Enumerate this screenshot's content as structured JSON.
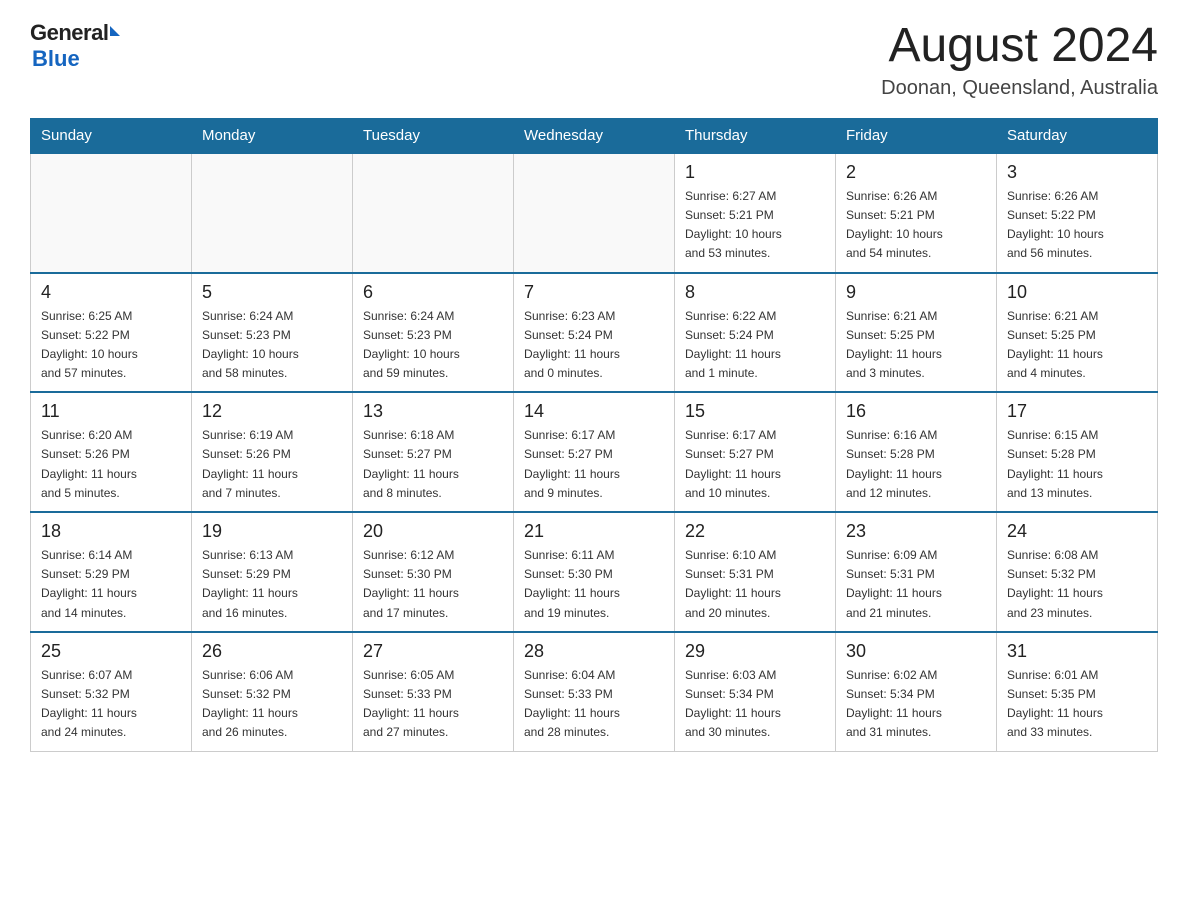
{
  "logo": {
    "general": "General",
    "blue": "Blue"
  },
  "header": {
    "title": "August 2024",
    "subtitle": "Doonan, Queensland, Australia"
  },
  "days_of_week": [
    "Sunday",
    "Monday",
    "Tuesday",
    "Wednesday",
    "Thursday",
    "Friday",
    "Saturday"
  ],
  "weeks": [
    [
      {
        "day": "",
        "info": ""
      },
      {
        "day": "",
        "info": ""
      },
      {
        "day": "",
        "info": ""
      },
      {
        "day": "",
        "info": ""
      },
      {
        "day": "1",
        "info": "Sunrise: 6:27 AM\nSunset: 5:21 PM\nDaylight: 10 hours\nand 53 minutes."
      },
      {
        "day": "2",
        "info": "Sunrise: 6:26 AM\nSunset: 5:21 PM\nDaylight: 10 hours\nand 54 minutes."
      },
      {
        "day": "3",
        "info": "Sunrise: 6:26 AM\nSunset: 5:22 PM\nDaylight: 10 hours\nand 56 minutes."
      }
    ],
    [
      {
        "day": "4",
        "info": "Sunrise: 6:25 AM\nSunset: 5:22 PM\nDaylight: 10 hours\nand 57 minutes."
      },
      {
        "day": "5",
        "info": "Sunrise: 6:24 AM\nSunset: 5:23 PM\nDaylight: 10 hours\nand 58 minutes."
      },
      {
        "day": "6",
        "info": "Sunrise: 6:24 AM\nSunset: 5:23 PM\nDaylight: 10 hours\nand 59 minutes."
      },
      {
        "day": "7",
        "info": "Sunrise: 6:23 AM\nSunset: 5:24 PM\nDaylight: 11 hours\nand 0 minutes."
      },
      {
        "day": "8",
        "info": "Sunrise: 6:22 AM\nSunset: 5:24 PM\nDaylight: 11 hours\nand 1 minute."
      },
      {
        "day": "9",
        "info": "Sunrise: 6:21 AM\nSunset: 5:25 PM\nDaylight: 11 hours\nand 3 minutes."
      },
      {
        "day": "10",
        "info": "Sunrise: 6:21 AM\nSunset: 5:25 PM\nDaylight: 11 hours\nand 4 minutes."
      }
    ],
    [
      {
        "day": "11",
        "info": "Sunrise: 6:20 AM\nSunset: 5:26 PM\nDaylight: 11 hours\nand 5 minutes."
      },
      {
        "day": "12",
        "info": "Sunrise: 6:19 AM\nSunset: 5:26 PM\nDaylight: 11 hours\nand 7 minutes."
      },
      {
        "day": "13",
        "info": "Sunrise: 6:18 AM\nSunset: 5:27 PM\nDaylight: 11 hours\nand 8 minutes."
      },
      {
        "day": "14",
        "info": "Sunrise: 6:17 AM\nSunset: 5:27 PM\nDaylight: 11 hours\nand 9 minutes."
      },
      {
        "day": "15",
        "info": "Sunrise: 6:17 AM\nSunset: 5:27 PM\nDaylight: 11 hours\nand 10 minutes."
      },
      {
        "day": "16",
        "info": "Sunrise: 6:16 AM\nSunset: 5:28 PM\nDaylight: 11 hours\nand 12 minutes."
      },
      {
        "day": "17",
        "info": "Sunrise: 6:15 AM\nSunset: 5:28 PM\nDaylight: 11 hours\nand 13 minutes."
      }
    ],
    [
      {
        "day": "18",
        "info": "Sunrise: 6:14 AM\nSunset: 5:29 PM\nDaylight: 11 hours\nand 14 minutes."
      },
      {
        "day": "19",
        "info": "Sunrise: 6:13 AM\nSunset: 5:29 PM\nDaylight: 11 hours\nand 16 minutes."
      },
      {
        "day": "20",
        "info": "Sunrise: 6:12 AM\nSunset: 5:30 PM\nDaylight: 11 hours\nand 17 minutes."
      },
      {
        "day": "21",
        "info": "Sunrise: 6:11 AM\nSunset: 5:30 PM\nDaylight: 11 hours\nand 19 minutes."
      },
      {
        "day": "22",
        "info": "Sunrise: 6:10 AM\nSunset: 5:31 PM\nDaylight: 11 hours\nand 20 minutes."
      },
      {
        "day": "23",
        "info": "Sunrise: 6:09 AM\nSunset: 5:31 PM\nDaylight: 11 hours\nand 21 minutes."
      },
      {
        "day": "24",
        "info": "Sunrise: 6:08 AM\nSunset: 5:32 PM\nDaylight: 11 hours\nand 23 minutes."
      }
    ],
    [
      {
        "day": "25",
        "info": "Sunrise: 6:07 AM\nSunset: 5:32 PM\nDaylight: 11 hours\nand 24 minutes."
      },
      {
        "day": "26",
        "info": "Sunrise: 6:06 AM\nSunset: 5:32 PM\nDaylight: 11 hours\nand 26 minutes."
      },
      {
        "day": "27",
        "info": "Sunrise: 6:05 AM\nSunset: 5:33 PM\nDaylight: 11 hours\nand 27 minutes."
      },
      {
        "day": "28",
        "info": "Sunrise: 6:04 AM\nSunset: 5:33 PM\nDaylight: 11 hours\nand 28 minutes."
      },
      {
        "day": "29",
        "info": "Sunrise: 6:03 AM\nSunset: 5:34 PM\nDaylight: 11 hours\nand 30 minutes."
      },
      {
        "day": "30",
        "info": "Sunrise: 6:02 AM\nSunset: 5:34 PM\nDaylight: 11 hours\nand 31 minutes."
      },
      {
        "day": "31",
        "info": "Sunrise: 6:01 AM\nSunset: 5:35 PM\nDaylight: 11 hours\nand 33 minutes."
      }
    ]
  ]
}
